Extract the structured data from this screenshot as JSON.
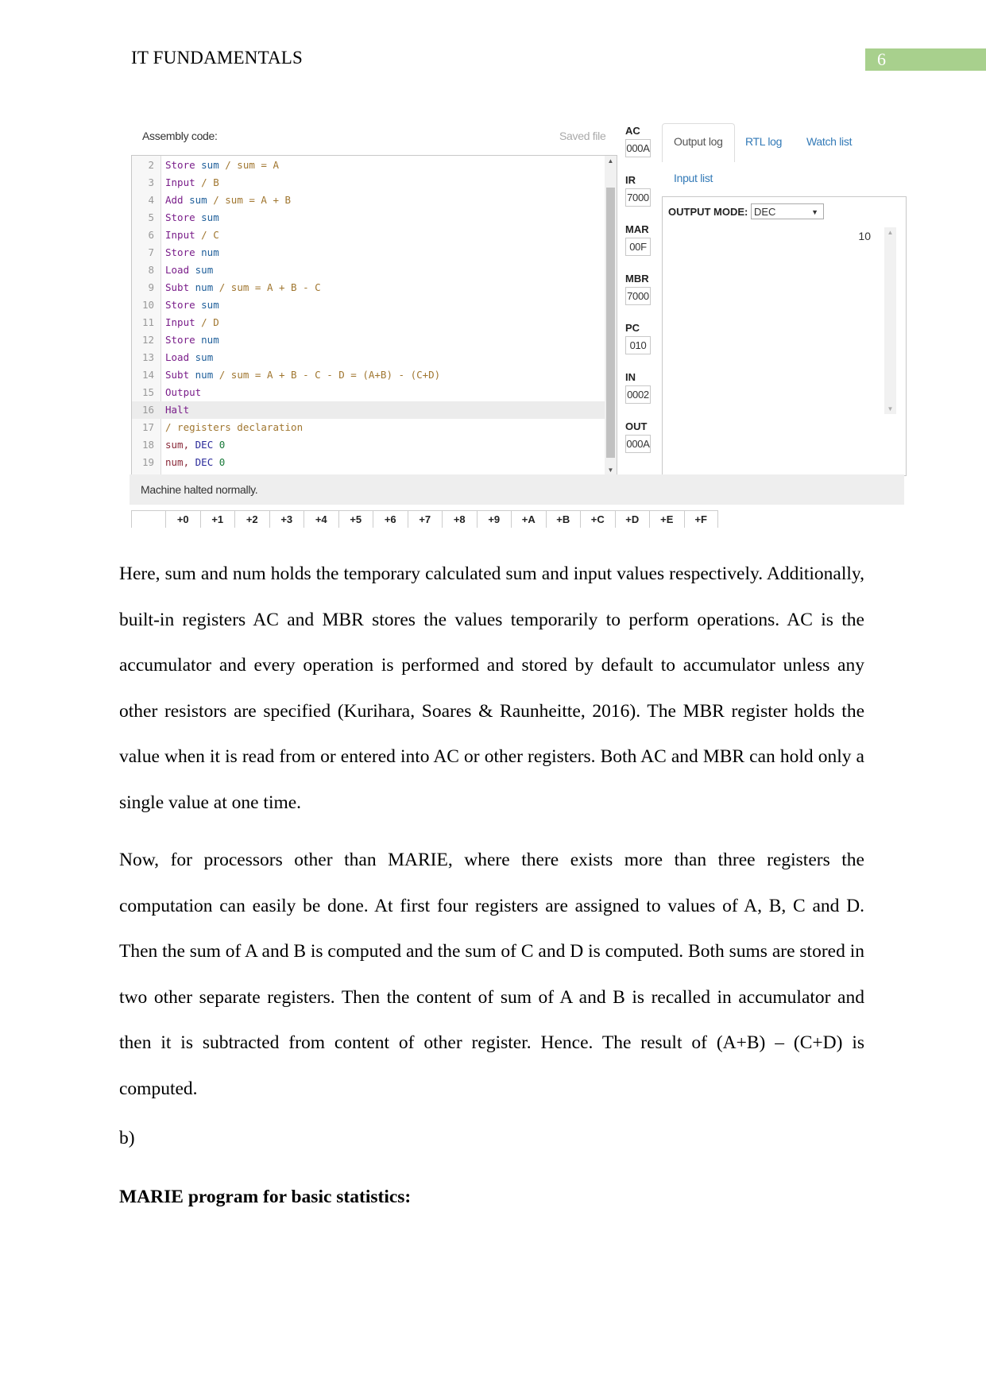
{
  "header": {
    "running_title": "IT FUNDAMENTALS",
    "page_number": "6",
    "page_number_color": "#a8d08d"
  },
  "simulator": {
    "assembly_label": "Assembly code:",
    "saved_file_label": "Saved file",
    "code_lines": [
      {
        "n": "2",
        "tokens": [
          [
            "kw",
            "Store "
          ],
          [
            "var",
            "sum"
          ],
          [
            "cmt",
            " / sum = A"
          ]
        ]
      },
      {
        "n": "3",
        "tokens": [
          [
            "kw",
            "Input"
          ],
          [
            "cmt",
            " / B"
          ]
        ]
      },
      {
        "n": "4",
        "tokens": [
          [
            "kw",
            "Add "
          ],
          [
            "var",
            "sum"
          ],
          [
            "cmt",
            " / sum = A + B"
          ]
        ]
      },
      {
        "n": "5",
        "tokens": [
          [
            "kw",
            "Store "
          ],
          [
            "var",
            "sum"
          ]
        ]
      },
      {
        "n": "6",
        "tokens": [
          [
            "kw",
            "Input"
          ],
          [
            "cmt",
            " / C"
          ]
        ]
      },
      {
        "n": "7",
        "tokens": [
          [
            "kw",
            "Store "
          ],
          [
            "var",
            "num"
          ]
        ]
      },
      {
        "n": "8",
        "tokens": [
          [
            "kw",
            "Load "
          ],
          [
            "var",
            "sum"
          ]
        ]
      },
      {
        "n": "9",
        "tokens": [
          [
            "kw",
            "Subt "
          ],
          [
            "var",
            "num"
          ],
          [
            "cmt",
            " / sum = A + B - C"
          ]
        ]
      },
      {
        "n": "10",
        "tokens": [
          [
            "kw",
            "Store "
          ],
          [
            "var",
            "sum"
          ]
        ]
      },
      {
        "n": "11",
        "tokens": [
          [
            "kw",
            "Input"
          ],
          [
            "cmt",
            " / D"
          ]
        ]
      },
      {
        "n": "12",
        "tokens": [
          [
            "kw",
            "Store "
          ],
          [
            "var",
            "num"
          ]
        ]
      },
      {
        "n": "13",
        "tokens": [
          [
            "kw",
            "Load "
          ],
          [
            "var",
            "sum"
          ]
        ]
      },
      {
        "n": "14",
        "tokens": [
          [
            "kw",
            "Subt "
          ],
          [
            "var",
            "num"
          ],
          [
            "cmt",
            " / sum = A + B - C - D = (A+B) - (C+D)"
          ]
        ]
      },
      {
        "n": "15",
        "tokens": [
          [
            "kw",
            "Output"
          ]
        ]
      },
      {
        "n": "16",
        "tokens": [
          [
            "kw",
            "Halt"
          ]
        ],
        "active": true
      },
      {
        "n": "17",
        "tokens": [
          [
            "cmt",
            "/ registers declaration"
          ]
        ]
      },
      {
        "n": "18",
        "tokens": [
          [
            "lbl",
            "sum, "
          ],
          [
            "dir",
            "DEC "
          ],
          [
            "num",
            "0"
          ]
        ]
      },
      {
        "n": "19",
        "tokens": [
          [
            "lbl",
            "num, "
          ],
          [
            "dir",
            "DEC "
          ],
          [
            "num",
            "0"
          ]
        ]
      }
    ],
    "registers": [
      {
        "name": "AC",
        "value": "000A"
      },
      {
        "name": "IR",
        "value": "7000"
      },
      {
        "name": "MAR",
        "value": "00F"
      },
      {
        "name": "MBR",
        "value": "7000"
      },
      {
        "name": "PC",
        "value": "010"
      },
      {
        "name": "IN",
        "value": "0002"
      },
      {
        "name": "OUT",
        "value": "000A"
      }
    ],
    "tabs": [
      "Output log",
      "RTL log",
      "Watch list",
      "Input list"
    ],
    "active_tab": "Output log",
    "output_mode_label": "OUTPUT MODE:",
    "output_mode_value": "DEC",
    "output_values": [
      "10"
    ],
    "status_message": "Machine halted normally.",
    "memory_columns": [
      "+0",
      "+1",
      "+2",
      "+3",
      "+4",
      "+5",
      "+6",
      "+7",
      "+8",
      "+9",
      "+A",
      "+B",
      "+C",
      "+D",
      "+E",
      "+F"
    ]
  },
  "body": {
    "paragraph_1": "Here, sum and num holds the temporary calculated sum and input values respectively. Additionally, built-in registers AC and MBR stores the values temporarily to perform operations. AC is the accumulator and every operation is performed and stored by default to accumulator unless any other resistors are specified (Kurihara, Soares & Raunheitte, 2016). The MBR register holds the value when it is read from or entered into AC or other registers. Both AC and MBR can hold only a single value at one time.",
    "paragraph_2": "Now, for processors other than MARIE, where there exists more than three registers the computation can easily be done. At first four registers are assigned to values of A, B, C and D. Then the sum of A and B is computed and the sum of C and D is computed. Both sums are stored in two other separate registers. Then the content of sum of A and B is recalled in accumulator and then it is subtracted from content of other register. Hence. The result of (A+B) – (C+D) is computed.",
    "part_label": "b)",
    "section_title": "MARIE program for basic statistics:"
  }
}
